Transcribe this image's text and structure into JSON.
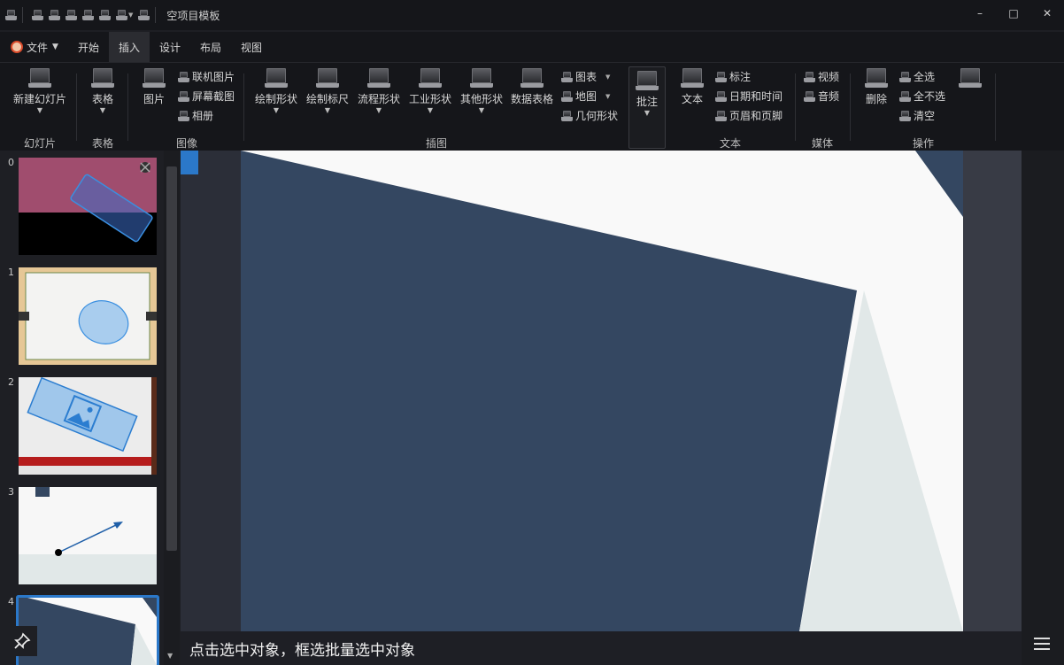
{
  "window": {
    "title": "空项目模板",
    "controls": {
      "minimize": "–",
      "maximize": "□",
      "close": "✕"
    }
  },
  "menu": {
    "file": "文件",
    "tabs": [
      "开始",
      "插入",
      "设计",
      "布局",
      "视图"
    ],
    "active_tab": "插入"
  },
  "ribbon": {
    "groups": {
      "slides": "幻灯片",
      "table": "表格",
      "image": "图像",
      "illustration": "插图",
      "text": "文本",
      "media": "媒体",
      "operation": "操作"
    },
    "buttons": {
      "new_slide": "新建幻灯片",
      "table": "表格",
      "picture": "图片",
      "online_picture": "联机图片",
      "screenshot": "屏幕截图",
      "album": "相册",
      "draw_shape": "绘制形状",
      "draw_ruler": "绘制标尺",
      "flow_shape": "流程形状",
      "industrial_shape": "工业形状",
      "other_shape": "其他形状",
      "data_table": "数据表格",
      "chart": "图表",
      "map": "地图",
      "geometry": "几何形状",
      "annotation": "批注",
      "text": "文本",
      "callout": "标注",
      "datetime": "日期和时间",
      "header_footer": "页眉和页脚",
      "video": "视频",
      "audio": "音频",
      "delete": "删除",
      "select_all": "全选",
      "select_none": "全不选",
      "clear": "清空"
    }
  },
  "slides": {
    "numbers": [
      "0",
      "1",
      "2",
      "3",
      "4"
    ],
    "selected": "4"
  },
  "status": {
    "hint": "点击选中对象，框选批量选中对象"
  },
  "colors": {
    "accent": "#2b78c9",
    "slide_navy": "#344761",
    "slide_white": "#f9f9f9",
    "slide_grey": "#e1e8e8"
  }
}
